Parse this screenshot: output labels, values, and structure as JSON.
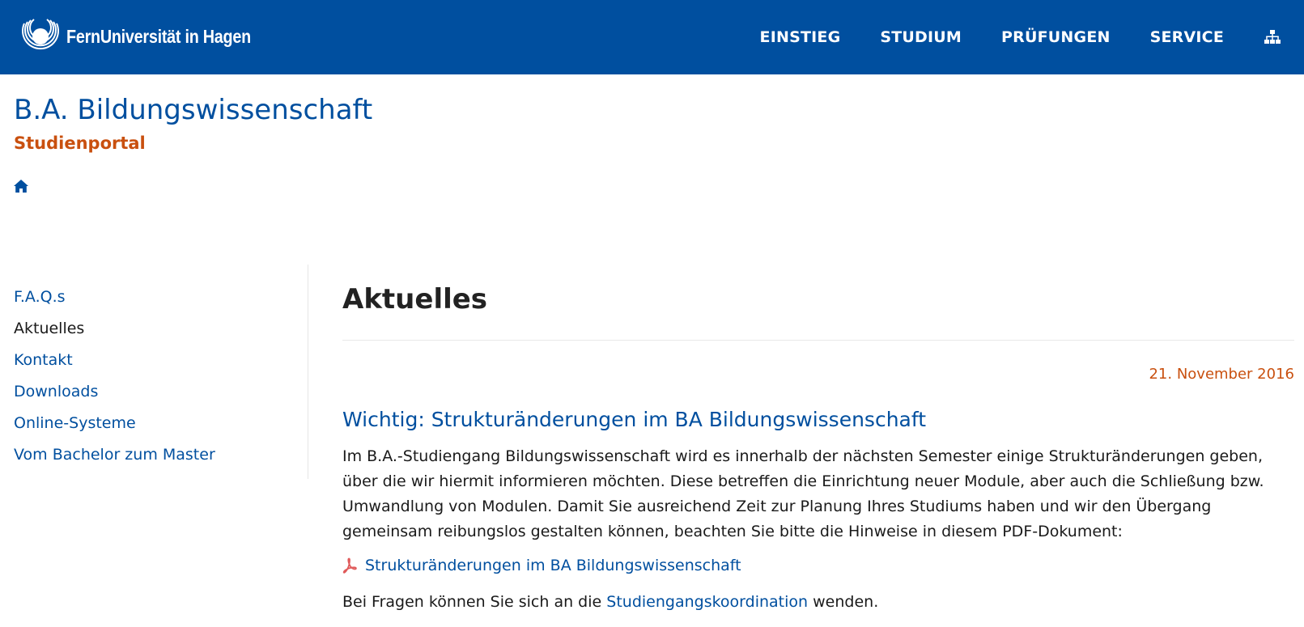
{
  "header": {
    "logo_text": "FernUniversität in Hagen",
    "brand_color": "#004f9f",
    "nav": [
      {
        "label": "EINSTIEG"
      },
      {
        "label": "STUDIUM"
      },
      {
        "label": "PRÜFUNGEN"
      },
      {
        "label": "SERVICE"
      }
    ],
    "sitemap_icon": "sitemap-icon"
  },
  "site": {
    "title": "B.A. Bildungswissenschaft",
    "subtitle": "Studienportal",
    "accent_color": "#c9500f",
    "home_icon": "home-icon"
  },
  "sidebar": {
    "items": [
      {
        "label": "F.A.Q.s",
        "current": false
      },
      {
        "label": "Aktuelles",
        "current": true
      },
      {
        "label": "Kontakt",
        "current": false
      },
      {
        "label": "Downloads",
        "current": false
      },
      {
        "label": "Online-Systeme",
        "current": false
      },
      {
        "label": "Vom Bachelor zum Master",
        "current": false
      }
    ]
  },
  "content": {
    "title": "Aktuelles",
    "news": {
      "date": "21. November 2016",
      "headline": "Wichtig: Strukturänderungen im BA Bildungswissenschaft",
      "body": "Im B.A.-Studiengang Bildungswissenschaft wird es innerhalb der nächsten Semester einige Strukturänderungen geben, über die wir hiermit informieren möchten. Diese betreffen die Einrichtung neuer Module, aber auch die Schließung bzw. Umwandlung von Modulen. Damit Sie ausreichend Zeit zur Planung Ihres Studiums haben und wir den Übergang gemeinsam reibungslos gestalten können, beachten Sie bitte die Hinweise in diesem PDF-Dokument:",
      "pdf_label": "Strukturänderungen im BA Bildungswissenschaft",
      "pdf_icon": "pdf-icon",
      "contact_prefix": "Bei Fragen können Sie sich an die",
      "contact_link": "Studiengangskoordination",
      "contact_suffix": "wenden."
    }
  }
}
